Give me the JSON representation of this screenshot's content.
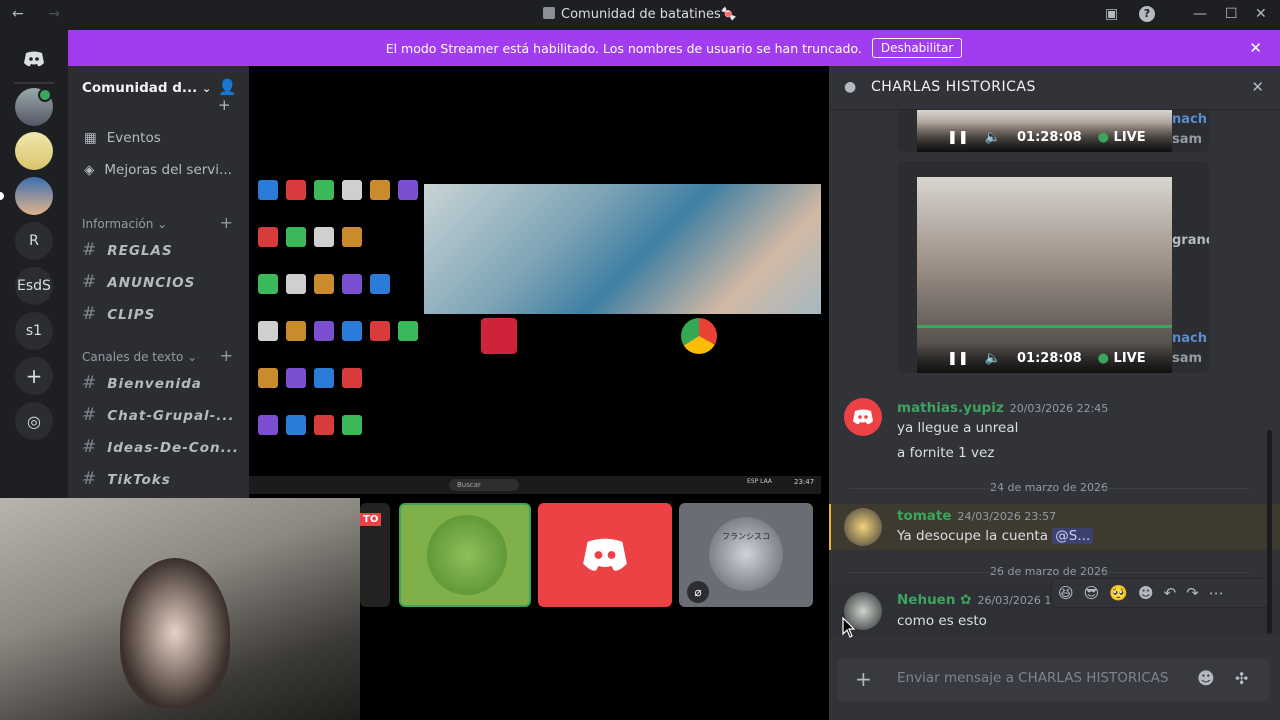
{
  "window": {
    "title": "Comunidad de batatines🍬",
    "back": "←",
    "forward": "→"
  },
  "banner": {
    "text": "El modo Streamer está habilitado. Los nombres de usuario se han truncado.",
    "button": "Deshabilitar"
  },
  "guilds": [
    {
      "label": "R"
    },
    {
      "label": "EsdS"
    },
    {
      "label": "s1"
    }
  ],
  "server": {
    "name": "Comunidad d..."
  },
  "sidebar": {
    "events": "Eventos",
    "boosts": "Mejoras del servi...",
    "cat_info": "Información",
    "info_channels": [
      "REGLAS",
      "ANUNCIOS",
      "CLIPS"
    ],
    "cat_text": "Canales de texto",
    "text_channels": [
      "Bienvenida",
      "Chat-Grupal-...",
      "Ideas-De-Con...",
      "TikToks"
    ]
  },
  "stream": {
    "live_badge": "TO",
    "avatar_label": "フランシスコ",
    "desktop_labels": [
      "Buscar",
      "23:47",
      "ESP LAA"
    ]
  },
  "chat": {
    "channel": "CHARLAS HISTORICAS",
    "video_time": "01:28:08",
    "video_live": "LIVE",
    "side_names": [
      "nach",
      "sam",
      "granc"
    ],
    "messages": [
      {
        "user": "mathias.yupiz",
        "time": "20/03/2026 22:45",
        "lines": [
          "ya llegue a unreal",
          "a fornite 1 vez"
        ],
        "color": "#3ba55d"
      },
      {
        "divider": "24 de marzo de 2026"
      },
      {
        "user": "tomate",
        "time": "24/03/2026 23:57",
        "lines": [
          "Ya desocupe la cuenta"
        ],
        "mention": "@S...",
        "color": "#3ba55d"
      },
      {
        "divider": "26 de marzo de 2026"
      },
      {
        "user": "Nehuen",
        "time": "26/03/2026 1:5",
        "lines": [
          "como es esto"
        ],
        "color": "#3ba55d"
      }
    ],
    "composer_placeholder": "Enviar mensaje a CHARLAS HISTORICAS"
  },
  "colors": {
    "banner": "#a23cf0",
    "discord_red": "#ed4245",
    "accent_green": "#3ba55d"
  }
}
